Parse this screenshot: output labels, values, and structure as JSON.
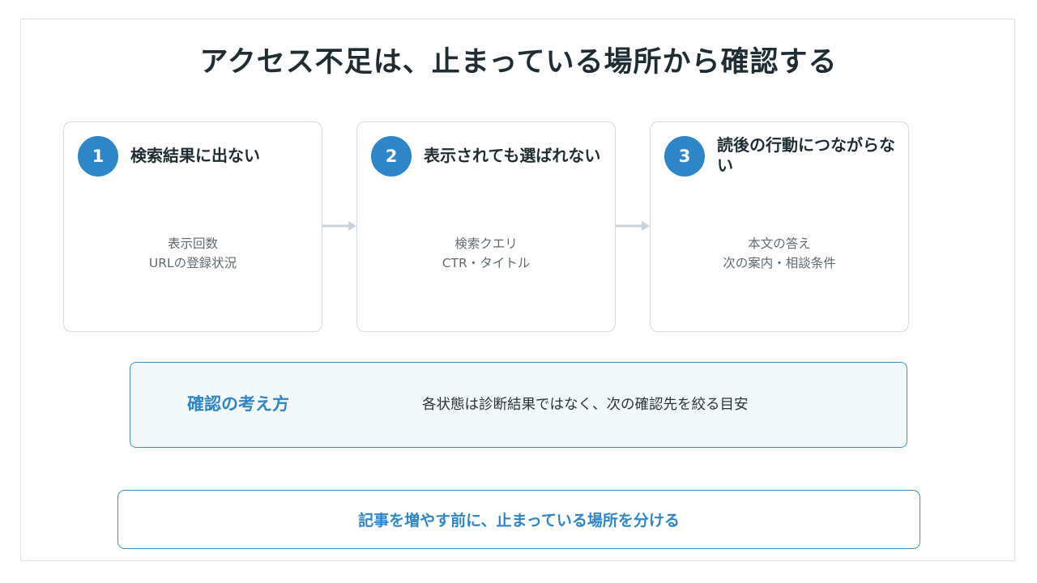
{
  "title": "アクセス不足は、止まっている場所から確認する",
  "steps": [
    {
      "number": "1",
      "title": "検索結果に出ない",
      "lines": [
        "表示回数",
        "URLの登録状況"
      ]
    },
    {
      "number": "2",
      "title": "表示されても選ばれない",
      "lines": [
        "検索クエリ",
        "CTR・タイトル"
      ]
    },
    {
      "number": "3",
      "title": "読後の行動につながらない",
      "lines": [
        "本文の答え",
        "次の案内・相談条件"
      ]
    }
  ],
  "note": {
    "label": "確認の考え方",
    "text": "各状態は診断結果ではなく、次の確認先を絞る目安"
  },
  "cta": {
    "text": "記事を増やす前に、止まっている場所を分ける"
  },
  "colors": {
    "accent": "#2e86c8",
    "title": "#1f2d33",
    "card_border": "#d4dde2",
    "arrow": "#c9d3d9",
    "note_background": "#f3f8fa"
  }
}
